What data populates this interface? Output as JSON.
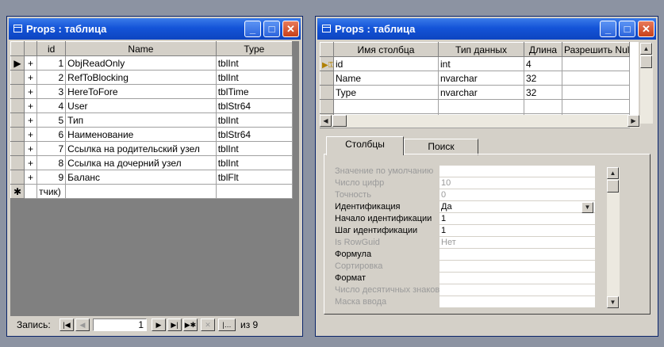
{
  "left_window": {
    "title": "Props : таблица",
    "columns": [
      "id",
      "Name",
      "Type"
    ],
    "rows": [
      {
        "id": "1",
        "name": "ObjReadOnly",
        "type": "tblInt"
      },
      {
        "id": "2",
        "name": "RefToBlocking",
        "type": "tblInt"
      },
      {
        "id": "3",
        "name": "HereToFore",
        "type": "tblTime"
      },
      {
        "id": "4",
        "name": "User",
        "type": "tblStr64"
      },
      {
        "id": "5",
        "name": "Тип",
        "type": "tblInt"
      },
      {
        "id": "6",
        "name": "Наименование",
        "type": "tblStr64"
      },
      {
        "id": "7",
        "name": "Ссылка на родительский узел",
        "type": "tblInt"
      },
      {
        "id": "8",
        "name": "Ссылка на дочерний узел",
        "type": "tblInt"
      },
      {
        "id": "9",
        "name": "Баланс",
        "type": "tblFlt"
      }
    ],
    "expander": "+",
    "new_row_marker": "✱",
    "new_row_id": "тчик)",
    "nav": {
      "label": "Запись:",
      "current": "1",
      "of_label": "из 9"
    }
  },
  "right_window": {
    "title": "Props : таблица",
    "columns": [
      "Имя столбца",
      "Тип данных",
      "Длина",
      "Разрешить Null"
    ],
    "rows": [
      {
        "name": "id",
        "type": "int",
        "length": "4"
      },
      {
        "name": "Name",
        "type": "nvarchar",
        "length": "32"
      },
      {
        "name": "Type",
        "type": "nvarchar",
        "length": "32"
      }
    ],
    "tabs": [
      "Столбцы",
      "Поиск"
    ],
    "properties": [
      {
        "label": "Значение по умолчанию",
        "value": "",
        "enabled": false
      },
      {
        "label": "Число цифр",
        "value": "10",
        "enabled": false
      },
      {
        "label": "Точность",
        "value": "0",
        "enabled": false
      },
      {
        "label": "Идентификация",
        "value": "Да",
        "enabled": true
      },
      {
        "label": "Начало идентификации",
        "value": "1",
        "enabled": true
      },
      {
        "label": "Шаг идентификации",
        "value": "1",
        "enabled": true
      },
      {
        "label": "Is RowGuid",
        "value": "Нет",
        "enabled": false
      },
      {
        "label": "Формула",
        "value": "",
        "enabled": true
      },
      {
        "label": "Сортировка",
        "value": "",
        "enabled": false
      },
      {
        "label": "Формат",
        "value": "",
        "enabled": true
      },
      {
        "label": "Число десятичных знаков",
        "value": "",
        "enabled": false
      },
      {
        "label": "Маска ввода",
        "value": "",
        "enabled": false
      }
    ]
  }
}
